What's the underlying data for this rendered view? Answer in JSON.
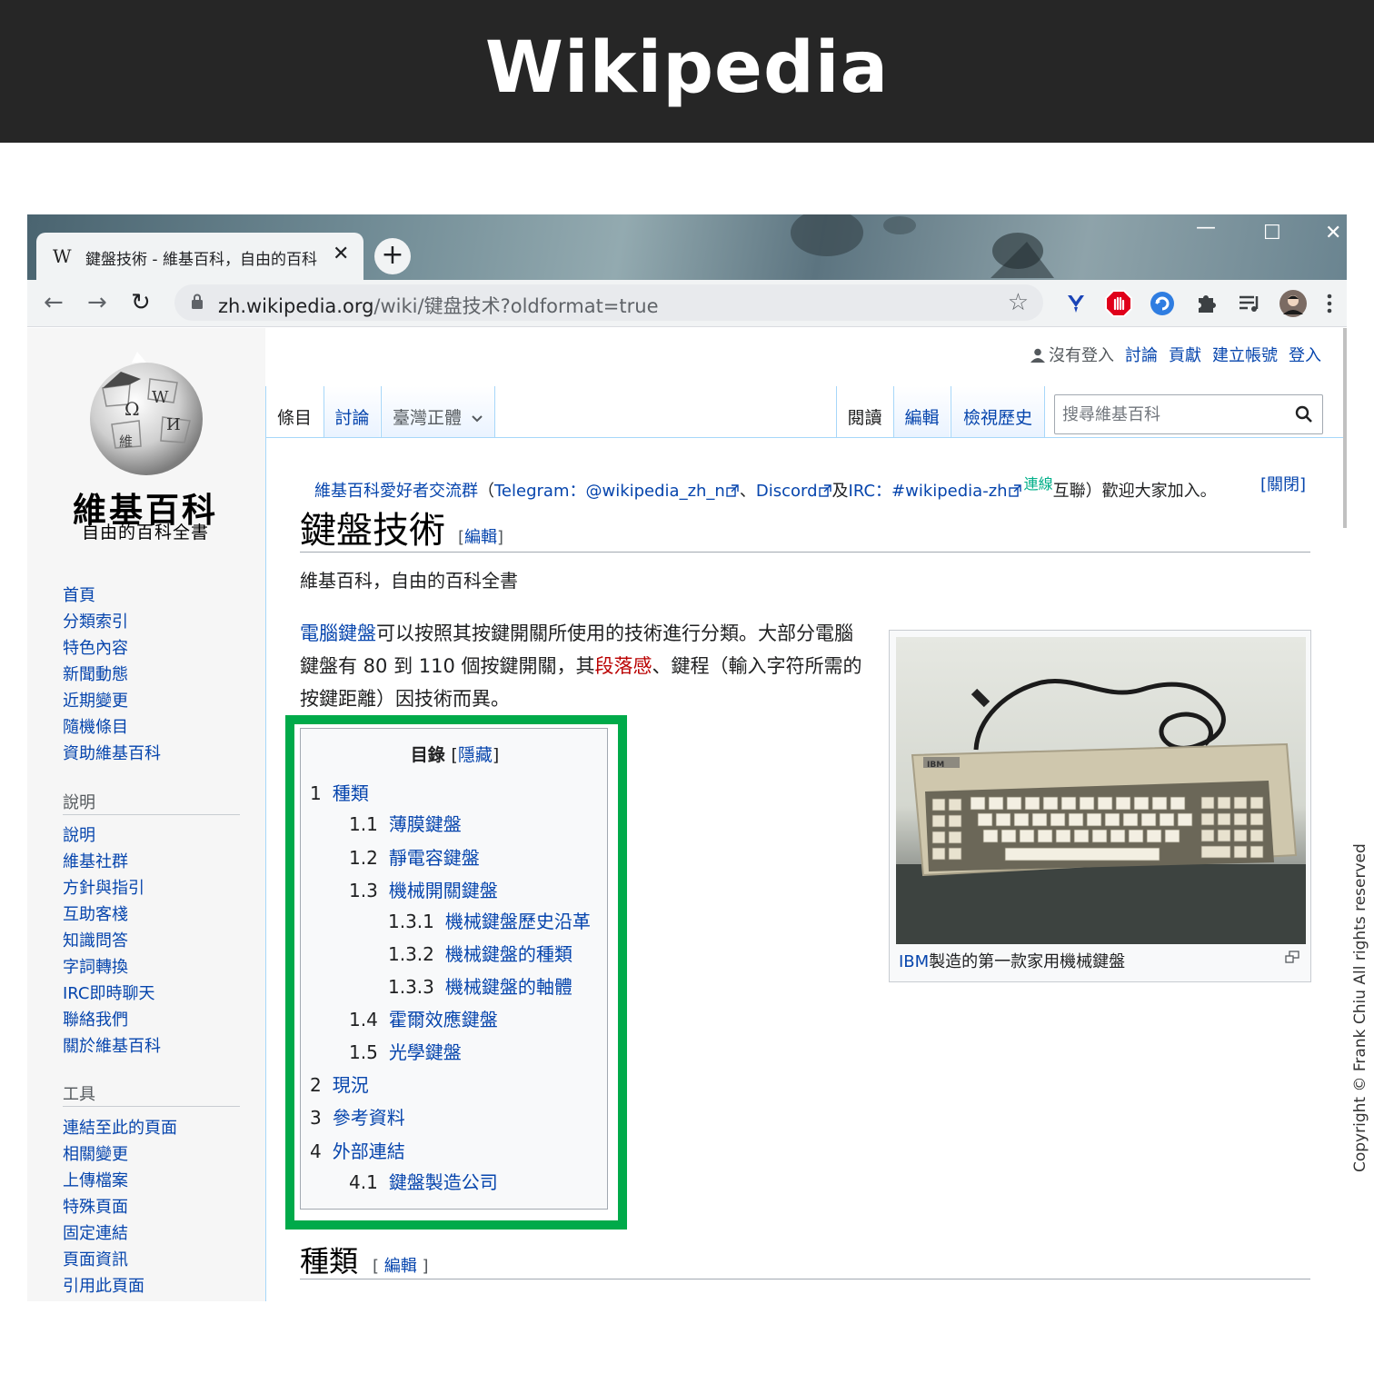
{
  "banner": {
    "title": "Wikipedia"
  },
  "browser": {
    "tab": {
      "favicon": "W",
      "title": "鍵盤技術 - 維基百科，自由的百科",
      "close": "✕"
    },
    "new_tab": "+",
    "window_controls": {
      "minimize": "—",
      "maximize": "☐",
      "close": "✕"
    },
    "nav": {
      "back": "←",
      "forward": "→",
      "reload": "↻"
    },
    "url": {
      "host": "zh.wikipedia.org",
      "path": "/wiki/键盘技术?oldformat=true"
    },
    "star": "☆",
    "extensions": [
      "yoroi-extension-icon",
      "adblock-icon",
      "refresh-extension-icon",
      "puzzle-extensions-icon",
      "media-queue-icon",
      "profile-avatar-icon",
      "kebab-menu-icon"
    ]
  },
  "logo": {
    "name": "維基百科",
    "tagline": "自由的百科全書"
  },
  "sidebar": {
    "nav": [
      "首頁",
      "分類索引",
      "特色內容",
      "新聞動態",
      "近期變更",
      "隨機條目",
      "資助維基百科"
    ],
    "help_heading": "說明",
    "help": [
      "說明",
      "維基社群",
      "方針與指引",
      "互助客棧",
      "知識問答",
      "字詞轉換",
      "IRC即時聊天",
      "聯絡我們",
      "關於維基百科"
    ],
    "tools_heading": "工具",
    "tools": [
      "連結至此的頁面",
      "相關變更",
      "上傳檔案",
      "特殊頁面",
      "固定連結",
      "頁面資訊",
      "引用此頁面"
    ]
  },
  "personal": {
    "not_logged_in": "沒有登入",
    "talk": "討論",
    "contributions": "貢獻",
    "create_account": "建立帳號",
    "login": "登入"
  },
  "tabs": {
    "article": "條目",
    "talk": "討論",
    "variant": "臺灣正體",
    "read": "閱讀",
    "edit": "編輯",
    "history": "檢視歷史"
  },
  "search": {
    "placeholder": "搜尋維基百科"
  },
  "notice": {
    "group": "維基百科愛好者交流群",
    "p1": "（",
    "telegram": "Telegram：@wikipedia_zh_n",
    "sep": "、",
    "discord": "Discord",
    "and": "及",
    "irc": "IRC：#wikipedia-zh",
    "sup": "連線",
    "tail": "互聯）歡迎大家加入。",
    "close": "[關閉]"
  },
  "article": {
    "title": "鍵盤技術",
    "edit_open": "[",
    "edit": "編輯",
    "edit_close": "]",
    "tagline": "維基百科，自由的百科全書",
    "intro": {
      "link1": "電腦鍵盤",
      "text1": "可以按照其按鍵開關所使用的技術進行分類。大部分電腦鍵盤有 80 到 110 個按鍵開關，其",
      "red_link": "段落感",
      "text2": "、鍵程（輸入字符所需的按鍵距離）因技術而異。"
    },
    "figure": {
      "caption_link": "IBM",
      "caption_text": "製造的第一款家用機械鍵盤"
    },
    "section_heading": "種類"
  },
  "toc": {
    "title": "目錄",
    "hide_open": "[",
    "hide": "隱藏",
    "hide_close": "]",
    "items": [
      {
        "num": "1",
        "text": "種類"
      },
      {
        "num": "1.1",
        "text": "薄膜鍵盤"
      },
      {
        "num": "1.2",
        "text": "靜電容鍵盤"
      },
      {
        "num": "1.3",
        "text": "機械開關鍵盤"
      },
      {
        "num": "1.3.1",
        "text": "機械鍵盤歷史沿革"
      },
      {
        "num": "1.3.2",
        "text": "機械鍵盤的種類"
      },
      {
        "num": "1.3.3",
        "text": "機械鍵盤的軸體"
      },
      {
        "num": "1.4",
        "text": "霍爾效應鍵盤"
      },
      {
        "num": "1.5",
        "text": "光學鍵盤"
      },
      {
        "num": "2",
        "text": "現況"
      },
      {
        "num": "3",
        "text": "參考資料"
      },
      {
        "num": "4",
        "text": "外部連結"
      },
      {
        "num": "4.1",
        "text": "鍵盤製造公司"
      }
    ]
  },
  "colors": {
    "link": "#0645ad",
    "redlink": "#ba0000",
    "highlight": "#00aa4a",
    "banner": "#262626"
  },
  "copyright": "Copyright © Frank Chiu All rights reserved"
}
